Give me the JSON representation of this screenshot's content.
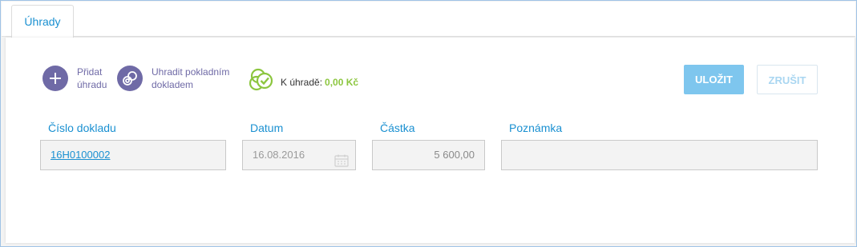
{
  "tab": {
    "label": "Úhrady"
  },
  "actions": {
    "add_payment": {
      "line1": "Přidat",
      "line2": "úhradu",
      "icon": "plus-icon"
    },
    "pay_cash": {
      "line1": "Uhradit pokladním",
      "line2": "dokladem",
      "icon": "coins-icon"
    }
  },
  "status": {
    "label": "K úhradě:",
    "amount": "0,00 Kč",
    "icon": "paid-check-icon"
  },
  "buttons": {
    "save": "ULOŽIT",
    "cancel": "ZRUŠIT"
  },
  "columns": {
    "document": "Číslo dokladu",
    "date": "Datum",
    "amount": "Částka",
    "note": "Poznámka"
  },
  "row": {
    "document": "16H0100002",
    "date": "16.08.2016",
    "amount": "5 600,00",
    "note": ""
  },
  "colors": {
    "accent": "#1a90d1",
    "action": "#6f6aa6",
    "positive": "#8cc63f",
    "save_button": "#7ec6ee"
  }
}
